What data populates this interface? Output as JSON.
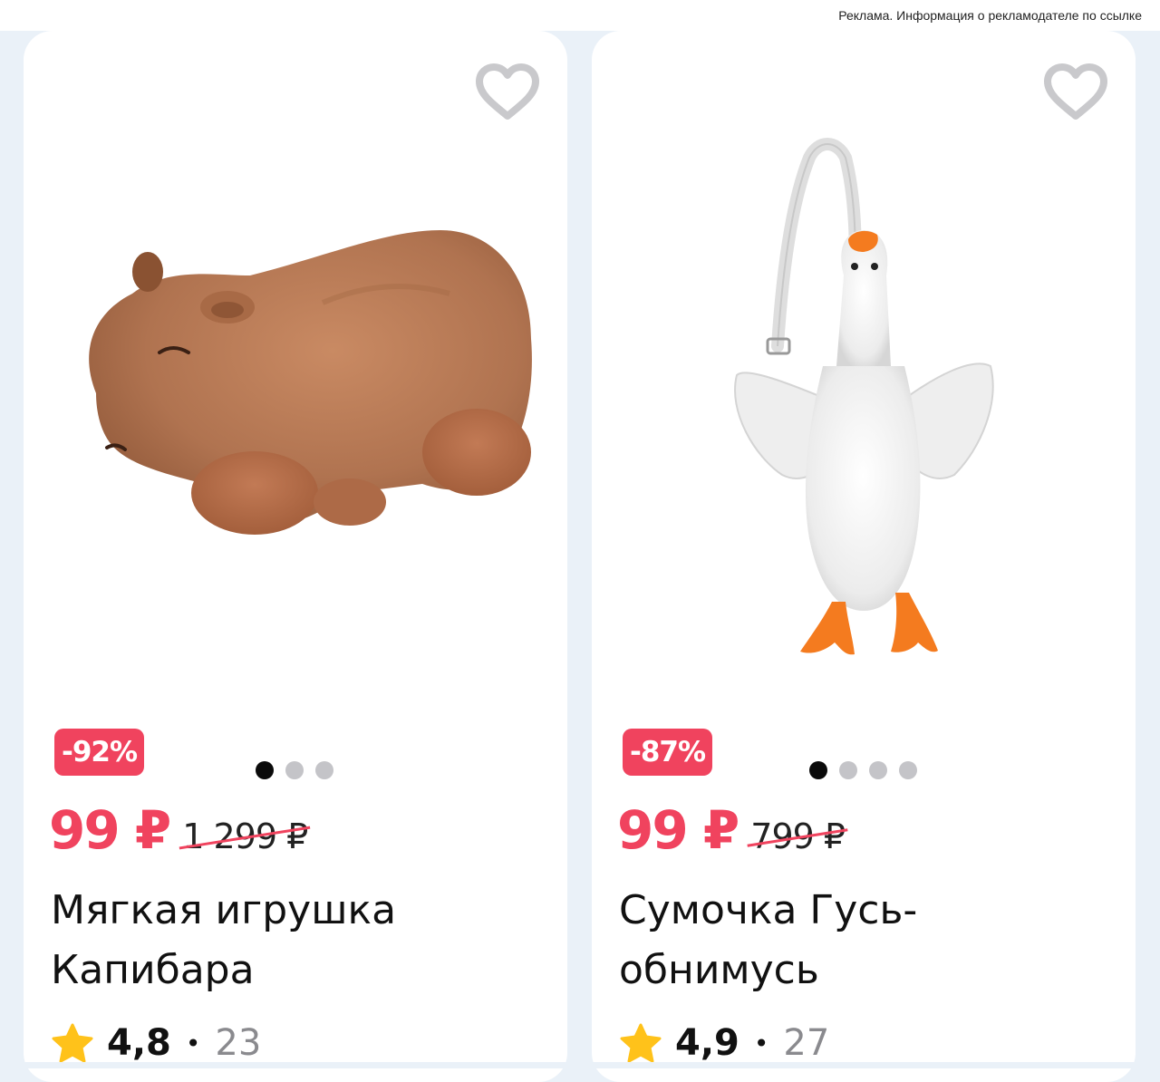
{
  "ad_notice": "Реклама. Информация о рекламодателе по ссылке",
  "colors": {
    "accent": "#f0435e",
    "page_background": "#eaf1f8",
    "star": "#ffc21a"
  },
  "products": [
    {
      "favorite_icon": "heart-outline-icon",
      "image": "plush-capybara-toy",
      "discount": "-92%",
      "gallery": {
        "count": 3,
        "active": 0
      },
      "price": "99 ₽",
      "old_price": "1 299 ₽",
      "title": "Мягкая игрушка Капибара",
      "rating": "4,8",
      "rating_separator": "•",
      "reviews": "23"
    },
    {
      "favorite_icon": "heart-outline-icon",
      "image": "plush-goose-bag",
      "discount": "-87%",
      "gallery": {
        "count": 4,
        "active": 0
      },
      "price": "99 ₽",
      "old_price": "799 ₽",
      "title": "Сумочка Гусь-обнимусь",
      "rating": "4,9",
      "rating_separator": "•",
      "reviews": "27"
    }
  ]
}
